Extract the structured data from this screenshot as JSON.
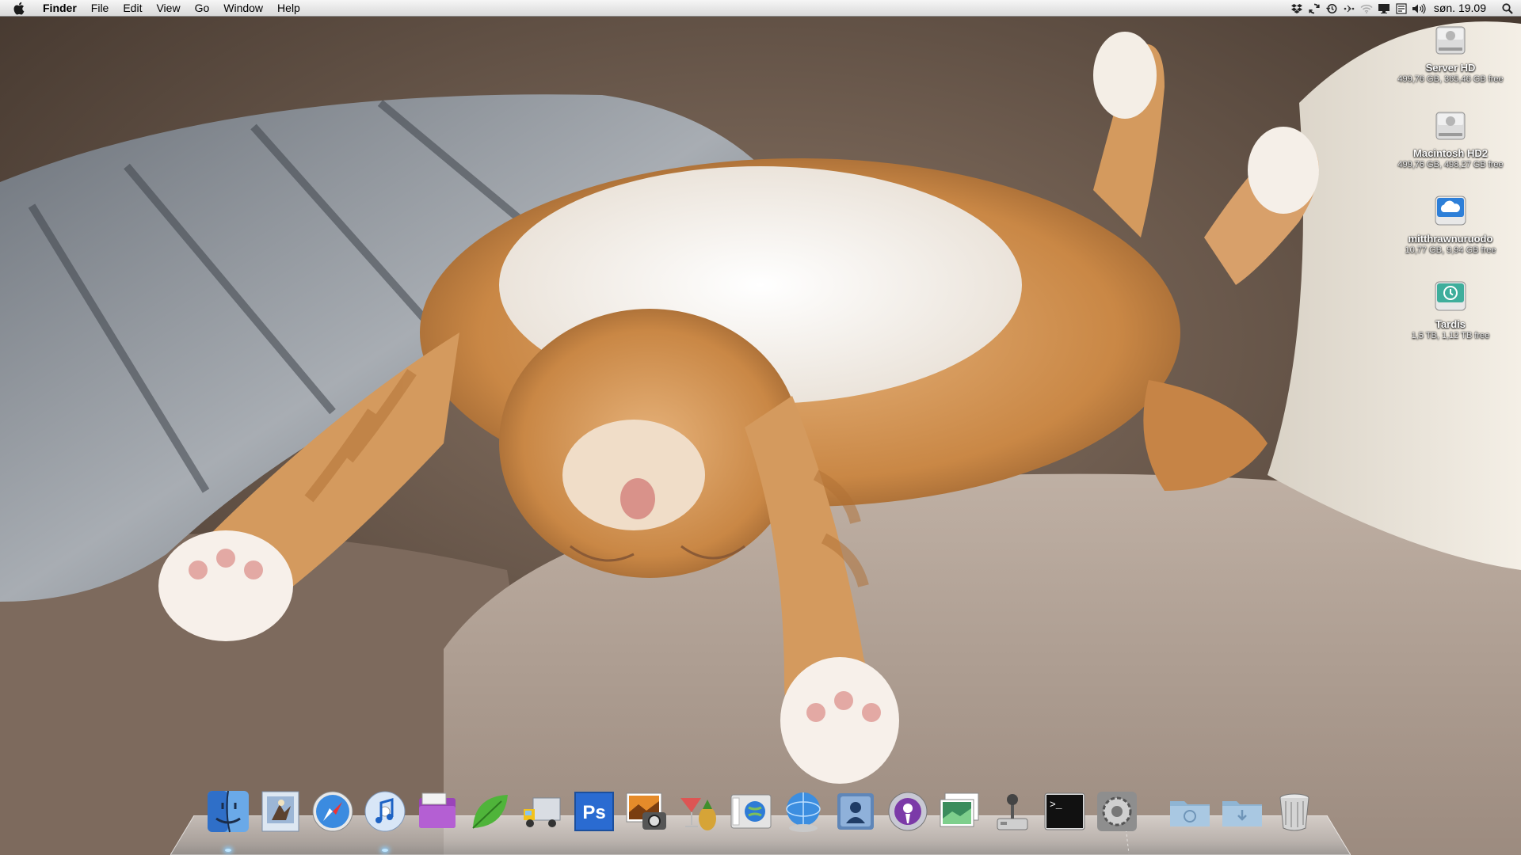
{
  "menubar": {
    "apple_icon": "apple-icon",
    "app_name": "Finder",
    "menus": [
      "File",
      "Edit",
      "View",
      "Go",
      "Window",
      "Help"
    ],
    "status_icons": [
      "dropbox-icon",
      "sync-icon",
      "time-machine-icon",
      "bluetooth-icon",
      "wifi-icon",
      "display-icon",
      "input-menu-icon",
      "volume-icon"
    ],
    "clock": "søn. 19.09",
    "spotlight_icon": "spotlight-search-icon"
  },
  "desktop": {
    "wallpaper": "sleeping-ginger-cat-photo",
    "drives": [
      {
        "name": "Server HD",
        "info": "499,76 GB, 365,46 GB free",
        "icon": "hard-drive-icon"
      },
      {
        "name": "Macintosh HD2",
        "info": "499,76 GB, 498,27 GB free",
        "icon": "hard-drive-icon"
      },
      {
        "name": "mitthrawnuruodo",
        "info": "10,77 GB, 9,94 GB free",
        "icon": "network-cloud-drive-icon"
      },
      {
        "name": "Tardis",
        "info": "1,5 TB, 1,12 TB free",
        "icon": "time-machine-drive-icon"
      }
    ]
  },
  "dock": {
    "items": [
      "finder-icon",
      "mail-icon",
      "safari-icon",
      "itunes-icon",
      "archive-app-icon",
      "leaf-app-icon",
      "transmit-truck-icon",
      "photoshop-icon",
      "iphoto-icon",
      "cocktail-icon",
      "preview-globe-icon",
      "network-globe-icon",
      "directory-utility-icon",
      "podcast-capture-icon",
      "image-viewer-icon",
      "joystick-icon",
      "terminal-icon",
      "system-preferences-icon",
      "applications-folder-icon",
      "downloads-folder-icon",
      "trash-icon"
    ],
    "photoshop_label": "Ps",
    "terminal_label": ">_"
  }
}
